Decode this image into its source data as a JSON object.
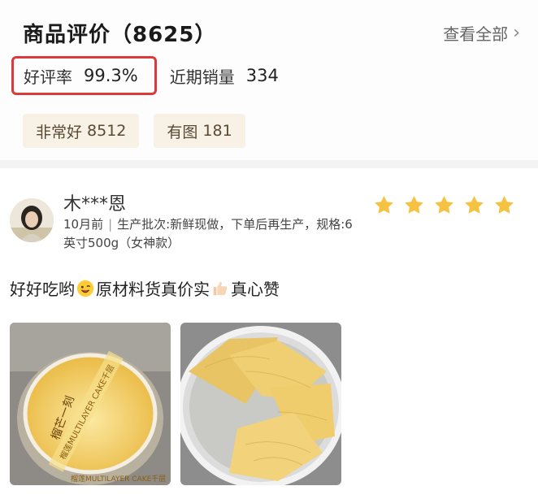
{
  "reviews_section": {
    "title": "商品评价（8625）",
    "view_all": "查看全部"
  },
  "stats": {
    "rating_label": "好评率",
    "rating_value": "99.3%",
    "sales_label": "近期销量",
    "sales_value": "334"
  },
  "tags": [
    {
      "label": "非常好",
      "count": "8512"
    },
    {
      "label": "有图",
      "count": "181"
    }
  ],
  "review": {
    "username": "木***恩",
    "time": "10月前",
    "separator": "|",
    "detail": "生产批次:新鲜现做，下单后再生产，规格:6英寸500g（女神款）",
    "stars": 5,
    "text_part1": "好好吃哟",
    "text_part2": "原材料货真价实",
    "text_part3": "真心赞"
  },
  "photo1_print": {
    "brand_cn": "榴芒一刻",
    "band_text": "榴莲MULTILAYER CAKE千层"
  },
  "colors": {
    "star": "#f5c242",
    "highlight_border": "#d93a3a",
    "tag_bg": "#f7f1e6"
  },
  "icons": [
    "chevron-right-icon",
    "star-icon",
    "smiley-icon",
    "thumbs-up-icon"
  ]
}
